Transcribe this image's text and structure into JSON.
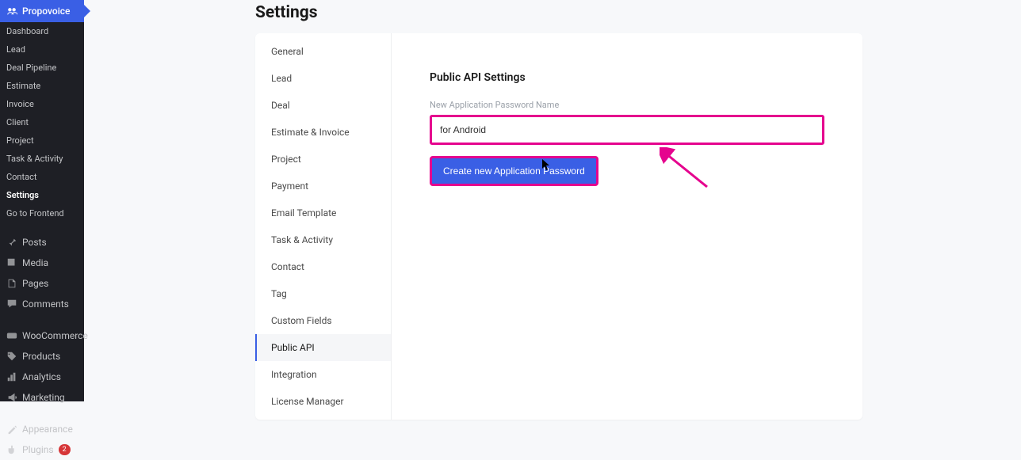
{
  "brand": {
    "label": "Propovoice"
  },
  "sidebar_top": [
    {
      "label": "Dashboard",
      "key": "dashboard"
    },
    {
      "label": "Lead",
      "key": "lead"
    },
    {
      "label": "Deal Pipeline",
      "key": "deal-pipeline"
    },
    {
      "label": "Estimate",
      "key": "estimate"
    },
    {
      "label": "Invoice",
      "key": "invoice"
    },
    {
      "label": "Client",
      "key": "client"
    },
    {
      "label": "Project",
      "key": "project"
    },
    {
      "label": "Task & Activity",
      "key": "task-activity"
    },
    {
      "label": "Contact",
      "key": "contact"
    },
    {
      "label": "Settings",
      "key": "settings",
      "active": true
    },
    {
      "label": "Go to Frontend",
      "key": "frontend"
    }
  ],
  "sidebar_main": [
    {
      "label": "Posts",
      "icon": "pin",
      "key": "posts"
    },
    {
      "label": "Media",
      "icon": "media",
      "key": "media"
    },
    {
      "label": "Pages",
      "icon": "pages",
      "key": "pages"
    },
    {
      "label": "Comments",
      "icon": "comment",
      "key": "comments"
    },
    {
      "label": "WooCommerce",
      "icon": "woo",
      "key": "woocommerce"
    },
    {
      "label": "Products",
      "icon": "product",
      "key": "products"
    },
    {
      "label": "Analytics",
      "icon": "analytics",
      "key": "analytics"
    },
    {
      "label": "Marketing",
      "icon": "marketing",
      "key": "marketing"
    },
    {
      "label": "Appearance",
      "icon": "appearance",
      "key": "appearance"
    },
    {
      "label": "Plugins",
      "icon": "plugin",
      "key": "plugins",
      "badge": "2"
    }
  ],
  "page": {
    "title": "Settings"
  },
  "settings_tabs": [
    {
      "label": "General",
      "key": "general"
    },
    {
      "label": "Lead",
      "key": "lead"
    },
    {
      "label": "Deal",
      "key": "deal"
    },
    {
      "label": "Estimate & Invoice",
      "key": "estimate-invoice"
    },
    {
      "label": "Project",
      "key": "project"
    },
    {
      "label": "Payment",
      "key": "payment"
    },
    {
      "label": "Email Template",
      "key": "email-template"
    },
    {
      "label": "Task & Activity",
      "key": "task-activity"
    },
    {
      "label": "Contact",
      "key": "contact"
    },
    {
      "label": "Tag",
      "key": "tag"
    },
    {
      "label": "Custom Fields",
      "key": "custom-fields"
    },
    {
      "label": "Public API",
      "key": "public-api",
      "active": true
    },
    {
      "label": "Integration",
      "key": "integration"
    },
    {
      "label": "License Manager",
      "key": "license-manager"
    }
  ],
  "content": {
    "title": "Public API Settings",
    "field_label": "New Application Password Name",
    "input_value": "for Android",
    "button_label": "Create new Application Password"
  }
}
